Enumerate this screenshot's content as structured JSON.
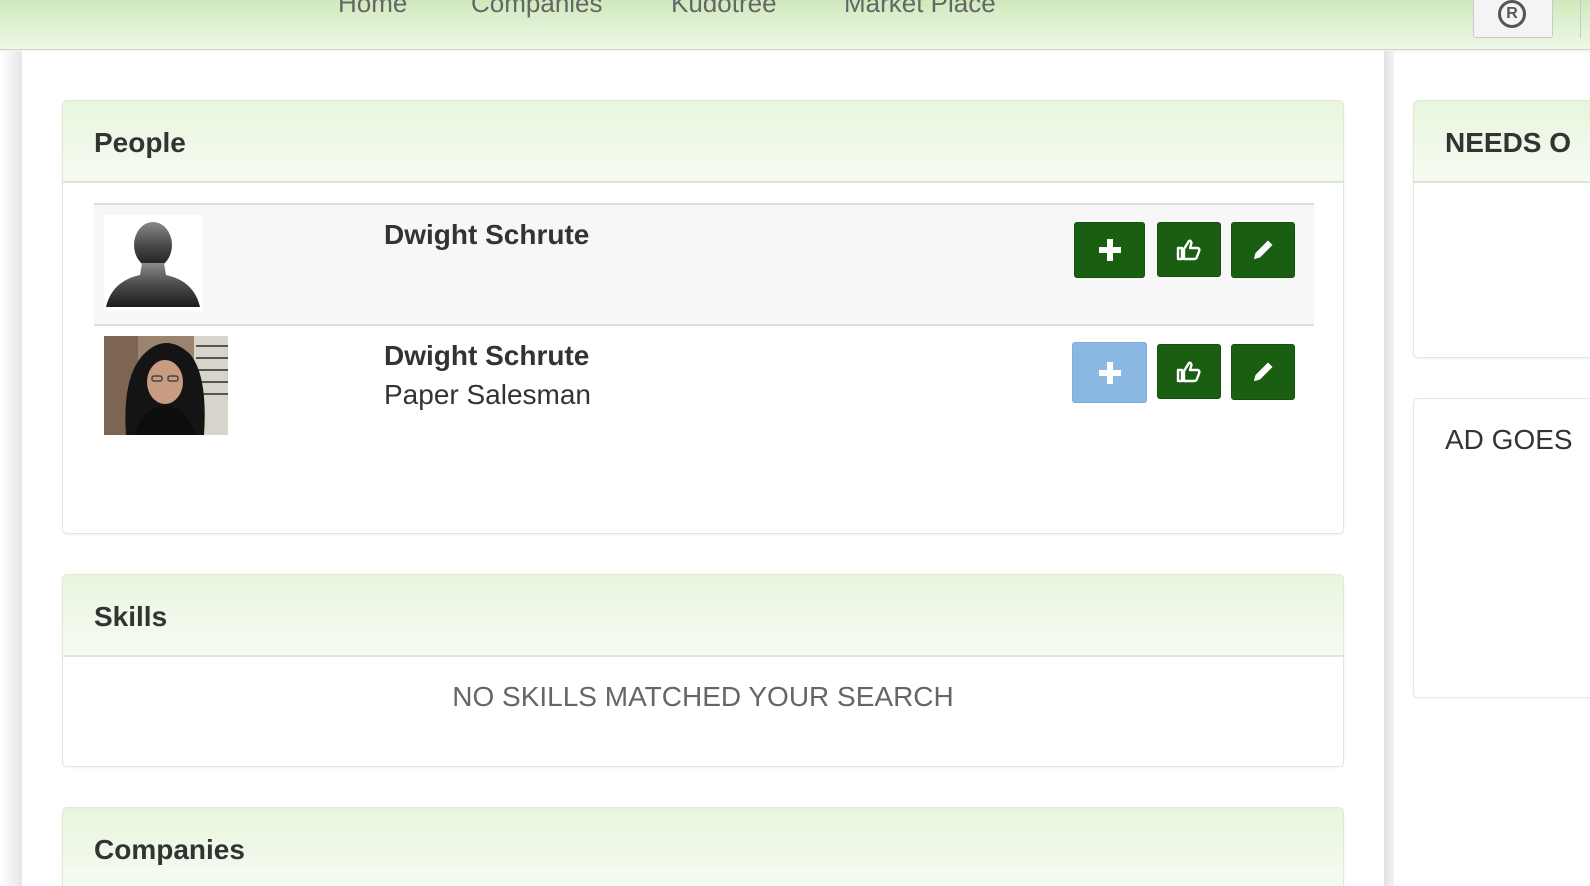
{
  "nav": {
    "links": [
      "Home",
      "Companies",
      "Kudotree",
      "Market Place"
    ],
    "reg_symbol": "R"
  },
  "people_panel": {
    "title": "People",
    "people": [
      {
        "name": "Dwight Schrute",
        "title": "",
        "avatar": "default-silhouette",
        "add_enabled": true
      },
      {
        "name": "Dwight Schrute",
        "title": "Paper Salesman",
        "avatar": "photo",
        "add_enabled": false
      }
    ]
  },
  "skills_panel": {
    "title": "Skills",
    "empty_message": "NO SKILLS MATCHED YOUR SEARCH"
  },
  "companies_panel": {
    "title": "Companies"
  },
  "sidebar": {
    "needs_title": "NEEDS O",
    "ad_text": "AD GOES"
  },
  "colors": {
    "button_green": "#1a5e12",
    "button_disabled_blue": "#8ab8e2",
    "heading_green": "#e8f5de"
  },
  "icons": [
    "plus-icon",
    "thumbs-up-icon",
    "pencil-icon",
    "registered-icon"
  ]
}
